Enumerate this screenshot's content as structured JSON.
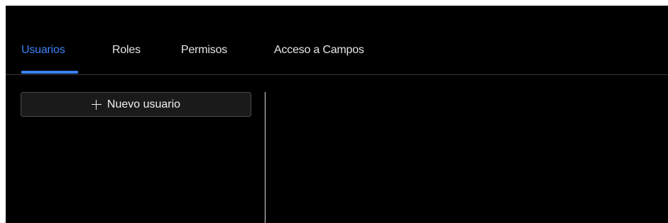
{
  "tabs": [
    {
      "label": "Usuarios",
      "active": true
    },
    {
      "label": "Roles",
      "active": false
    },
    {
      "label": "Permisos",
      "active": false
    },
    {
      "label": "Acceso a Campos",
      "active": false
    }
  ],
  "users_panel": {
    "new_user_label": "Nuevo usuario",
    "new_user_icon": "plus-icon"
  },
  "colors": {
    "background": "#000000",
    "accent": "#3b82f6",
    "text": "#e6e6e6",
    "button_bg": "#1a1a1a",
    "button_border": "#4a4a4a",
    "splitter": "#d8d8d8"
  }
}
